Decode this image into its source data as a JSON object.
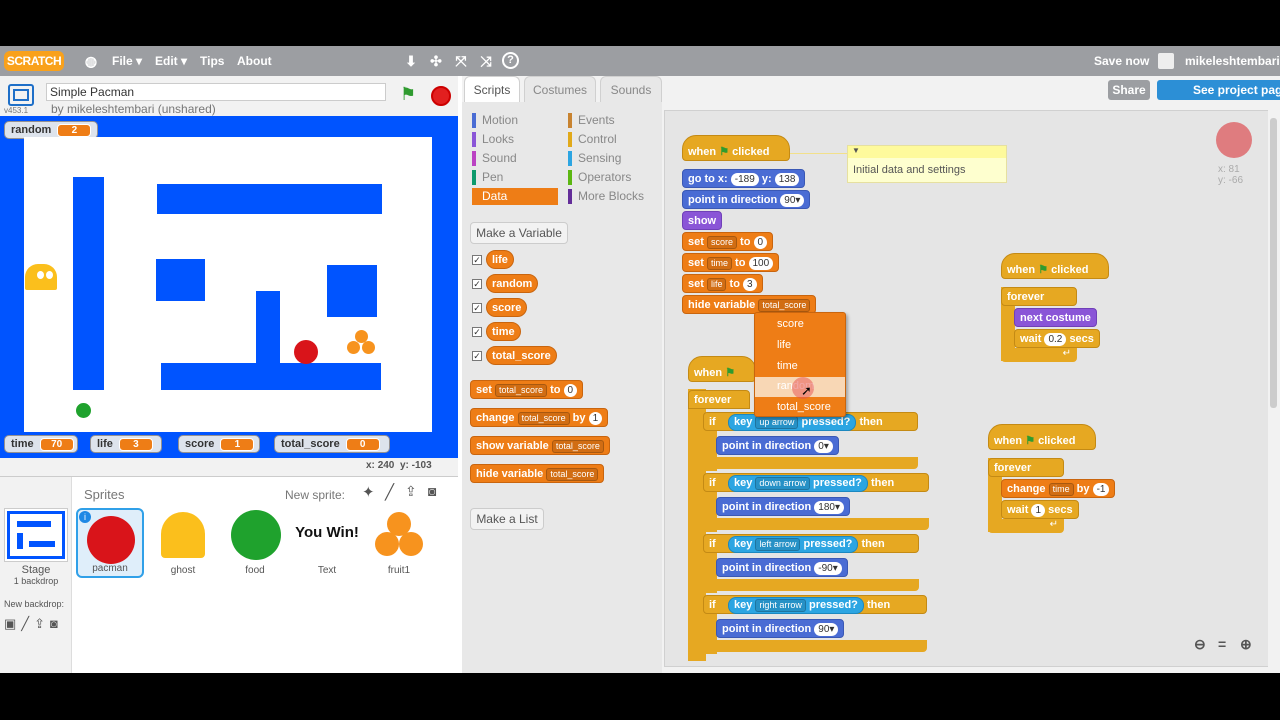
{
  "app": {
    "logo": "SCRATCH"
  },
  "menu": {
    "file": "File ▾",
    "edit": "Edit ▾",
    "tips": "Tips",
    "about": "About",
    "save_now": "Save now",
    "username": "mikeleshtembari"
  },
  "project": {
    "title": "Simple Pacman",
    "byline": "by mikeleshtembari (unshared)",
    "version": "v453.1",
    "share": "Share",
    "see_page": "See project page"
  },
  "tabs": {
    "scripts": "Scripts",
    "costumes": "Costumes",
    "sounds": "Sounds"
  },
  "monitors": {
    "random": {
      "label": "random",
      "value": "2"
    },
    "time": {
      "label": "time",
      "value": "70"
    },
    "life": {
      "label": "life",
      "value": "3"
    },
    "score": {
      "label": "score",
      "value": "1"
    },
    "total_score": {
      "label": "total_score",
      "value": "0"
    }
  },
  "mouse": {
    "x_label": "x:",
    "x": "240",
    "y_label": "y:",
    "y": "-103"
  },
  "categories": {
    "motion": "Motion",
    "looks": "Looks",
    "sound": "Sound",
    "pen": "Pen",
    "data": "Data",
    "events": "Events",
    "control": "Control",
    "sensing": "Sensing",
    "operators": "Operators",
    "more": "More Blocks"
  },
  "colors": {
    "motion": "#4a6cd4",
    "looks": "#8a55d7",
    "sound": "#bb42c3",
    "pen": "#0e9a6c",
    "data": "#ee7d16",
    "events": "#c88330",
    "control": "#e1a91a",
    "sensing": "#2ca5e2",
    "operators": "#5cb712",
    "more": "#632d99"
  },
  "palette": {
    "make_variable": "Make a Variable",
    "make_list": "Make a List",
    "variables": [
      "life",
      "random",
      "score",
      "time",
      "total_score"
    ],
    "set_block": {
      "a": "set",
      "var": "total_score",
      "b": "to",
      "val": "0"
    },
    "change_block": {
      "a": "change",
      "var": "total_score",
      "b": "by",
      "val": "1"
    },
    "show_block": {
      "a": "show variable",
      "var": "total_score"
    },
    "hide_block": {
      "a": "hide variable",
      "var": "total_score"
    }
  },
  "sprites_panel": {
    "title": "Sprites",
    "new_sprite": "New sprite:",
    "stage_label": "Stage",
    "stage_sub": "1 backdrop",
    "new_backdrop": "New backdrop:",
    "items": [
      "pacman",
      "ghost",
      "food",
      "Text",
      "fruit1"
    ],
    "text_sprite": "You Win!"
  },
  "scripts": {
    "hat1": {
      "when": "when",
      "clicked": "clicked"
    },
    "goto": {
      "a": "go to x:",
      "x": "-189",
      "b": "y:",
      "y": "138"
    },
    "point1": {
      "a": "point in direction",
      "v": "90▾"
    },
    "show": "show",
    "set_score": {
      "a": "set",
      "var": "score",
      "b": "to",
      "v": "0"
    },
    "set_time": {
      "a": "set",
      "var": "time",
      "b": "to",
      "v": "100"
    },
    "set_life": {
      "a": "set",
      "var": "life",
      "b": "to",
      "v": "3"
    },
    "hide_var": {
      "a": "hide variable",
      "var": "total_score"
    },
    "comment": "Initial data and settings",
    "dropdown": [
      "score",
      "life",
      "time",
      "random",
      "total_score"
    ],
    "hat2_when": "when",
    "forever": "forever",
    "if": "if",
    "then": "then",
    "key": "key",
    "pressed": "pressed?",
    "keys": [
      "up arrow",
      "down arrow",
      "left arrow",
      "right arrow"
    ],
    "point_dirs": [
      "0▾",
      "180▾",
      "-90▾",
      "90▾"
    ],
    "point_label": "point in direction",
    "hat3": {
      "when": "when",
      "clicked": "clicked",
      "forever": "forever",
      "next": "next costume",
      "wait": "wait",
      "secs_val": "0.2",
      "secs": "secs"
    },
    "hat4": {
      "when": "when",
      "clicked": "clicked",
      "forever": "forever",
      "change": "change",
      "var": "time",
      "by": "by",
      "val": "-1",
      "wait": "wait",
      "secs_val": "1",
      "secs": "secs"
    },
    "sprite_xy": {
      "x": "x: 81",
      "y": "y: -66"
    }
  }
}
